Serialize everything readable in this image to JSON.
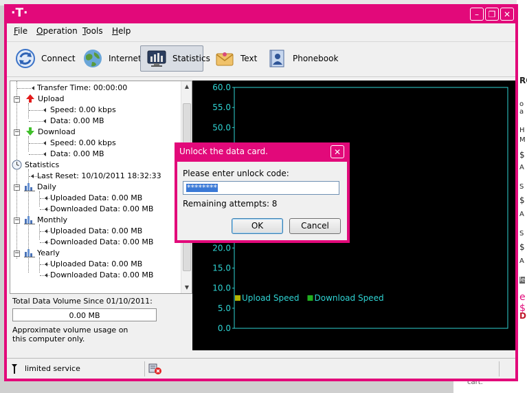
{
  "window": {
    "brand": "·T·",
    "controls": {
      "minimize": "–",
      "maximize": "❐",
      "close": "✕"
    }
  },
  "menu": [
    {
      "label": "File",
      "accel": "F",
      "rest": "ile"
    },
    {
      "label": "Operation",
      "accel": "O",
      "rest": "peration"
    },
    {
      "label": "Tools",
      "accel": "T",
      "rest": "ools"
    },
    {
      "label": "Help",
      "accel": "H",
      "rest": "elp"
    }
  ],
  "toolbar": {
    "connect": "Connect",
    "internet": "Internet",
    "statistics": "Statistics",
    "text": "Text",
    "phonebook": "Phonebook",
    "active": "statistics"
  },
  "tree": {
    "transfer_time": "Transfer Time: 00:00:00",
    "upload": "Upload",
    "upload_speed": "Speed: 0.00 kbps",
    "upload_data": "Data: 0.00 MB",
    "download": "Download",
    "download_speed": "Speed: 0.00 kbps",
    "download_data": "Data: 0.00 MB",
    "statistics": "Statistics",
    "last_reset": "Last Reset: 10/10/2011 18:32:33",
    "daily": "Daily",
    "daily_up": "Uploaded Data: 0.00 MB",
    "daily_down": "Downloaded Data: 0.00 MB",
    "monthly": "Monthly",
    "monthly_up": "Uploaded Data: 0.00 MB",
    "monthly_down": "Downloaded Data: 0.00 MB",
    "yearly": "Yearly",
    "yearly_up": "Uploaded Data: 0.00 MB",
    "yearly_down": "Downloaded Data: 0.00 MB"
  },
  "total": {
    "label": "Total Data Volume Since 01/10/2011:",
    "value": "0.00 MB",
    "note": "Approximate volume usage on this computer only."
  },
  "chart_data": {
    "type": "line",
    "y_ticks_visible": [
      "60.0",
      "55.0",
      "50.0",
      "20.0",
      "15.0",
      "10.0",
      "5.0",
      "0.0"
    ],
    "ylim": [
      0,
      60
    ],
    "grid": false,
    "legend_placement": "bottom-center",
    "series": [
      {
        "name": "Upload Speed",
        "color": "#b5b500",
        "values": []
      },
      {
        "name": "Download Speed",
        "color": "#1fae1f",
        "values": []
      }
    ],
    "axis_color": "#2fd4d4",
    "background": "#000000"
  },
  "status": {
    "text": "limited service"
  },
  "dialog": {
    "title": "Unlock the data card.",
    "prompt": "Please enter unlock code:",
    "code_masked": "********",
    "remaining": "Remaining attempts: 8",
    "ok": "OK",
    "cancel": "Cancel"
  },
  "background": {
    "bottom_fragment": "cart.",
    "right_fragments": [
      "RO",
      "o a",
      "H",
      "M",
      "$",
      "A",
      "S",
      "$",
      "A",
      "S",
      "$",
      "A",
      "le",
      "e $",
      "DR"
    ]
  }
}
